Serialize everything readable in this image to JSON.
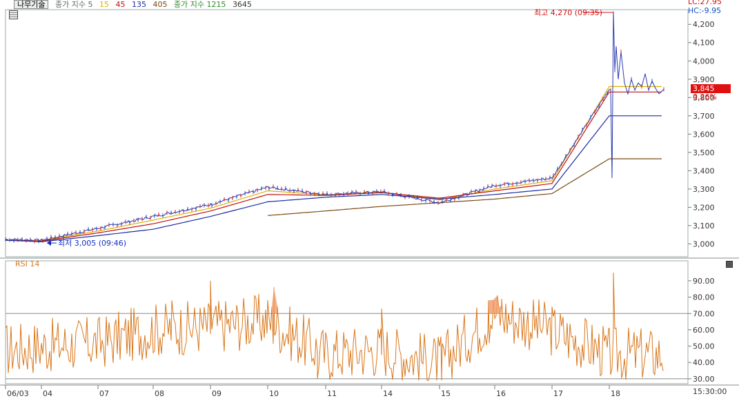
{
  "legend": {
    "mode_button": "나무기술",
    "ma_label": "종가 지수 5",
    "ma_periods": [
      "15",
      "45",
      "135",
      "405"
    ],
    "ma_colors": [
      "#e0b000",
      "#c01010",
      "#1a2aa0",
      "#7a4a10"
    ],
    "vol_label": "종가 지수 1215",
    "vol_extra": "3645"
  },
  "price_axis": {
    "ticks": [
      "4,200",
      "4,100",
      "4,000",
      "3,900",
      "3,800",
      "3,700",
      "3,600",
      "3,500",
      "3,400",
      "3,300",
      "3,200",
      "3,100",
      "3,000"
    ],
    "tick_values": [
      4200,
      4100,
      4000,
      3900,
      3800,
      3700,
      3600,
      3500,
      3400,
      3300,
      3200,
      3100,
      3000
    ],
    "current_price": "3,845",
    "current_change": "0.26%",
    "lc": "LC:27.95",
    "hc": "HC:-9.95"
  },
  "annotations": {
    "high": "최고 4,270 (09:35)",
    "low": "최저 3,005 (09:46)"
  },
  "rsi": {
    "label": "RSI 14",
    "ticks": [
      "90.00",
      "80.00",
      "70.00",
      "60.00",
      "50.00",
      "40.00",
      "30.00"
    ],
    "tick_values": [
      90,
      80,
      70,
      60,
      50,
      40,
      30
    ],
    "overbought": 70,
    "oversold": 30
  },
  "x_axis": {
    "labels": [
      "06/03",
      "04",
      "07",
      "08",
      "09",
      "10",
      "11",
      "14",
      "15",
      "16",
      "17",
      "18"
    ],
    "time_label": "15:30:00"
  },
  "chart_data": {
    "type": "line",
    "title": "",
    "x": [
      "06/03",
      "04",
      "07",
      "08",
      "09",
      "10",
      "11",
      "14",
      "15",
      "16",
      "17",
      "18"
    ],
    "ylim": [
      2930,
      4280
    ],
    "rsi_ylim": [
      27,
      98
    ],
    "series": [
      {
        "name": "종가",
        "values": [
          3025,
          3020,
          3085,
          3150,
          3215,
          3310,
          3270,
          3285,
          3225,
          3320,
          3360,
          3845
        ]
      },
      {
        "name": "15",
        "values": [
          3022,
          3018,
          3070,
          3130,
          3195,
          3290,
          3268,
          3283,
          3240,
          3300,
          3345,
          3860
        ]
      },
      {
        "name": "45",
        "values": [
          3020,
          3015,
          3060,
          3110,
          3180,
          3270,
          3265,
          3280,
          3250,
          3290,
          3330,
          3830
        ]
      },
      {
        "name": "135",
        "values": [
          3020,
          3012,
          3045,
          3080,
          3150,
          3230,
          3255,
          3270,
          3245,
          3270,
          3300,
          3700
        ]
      },
      {
        "name": "405",
        "values": [
          null,
          null,
          null,
          null,
          null,
          3155,
          3180,
          3205,
          3225,
          3245,
          3275,
          3465
        ]
      },
      {
        "name": "RSI 14",
        "values": [
          48,
          50,
          52,
          60,
          62,
          66,
          45,
          48,
          40,
          70,
          60,
          45
        ]
      }
    ]
  }
}
